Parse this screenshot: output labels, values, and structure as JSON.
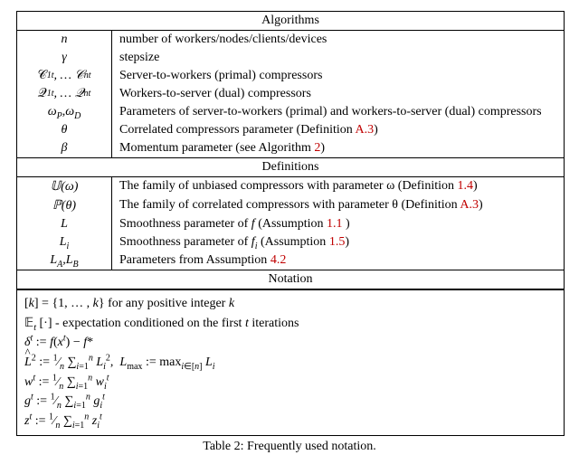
{
  "sections": {
    "algorithms": {
      "title": "Algorithms",
      "rows": [
        {
          "sym": "n",
          "desc_pre": "number of workers/nodes/clients/devices",
          "ref": "",
          "desc_post": ""
        },
        {
          "sym": "γ",
          "desc_pre": "stepsize",
          "ref": "",
          "desc_post": ""
        },
        {
          "sym": "C1t,…Cnt",
          "desc_pre": "Server-to-workers (primal) compressors",
          "ref": "",
          "desc_post": ""
        },
        {
          "sym": "Q1t,…Qnt",
          "desc_pre": "Workers-to-server (dual) compressors",
          "ref": "",
          "desc_post": ""
        },
        {
          "sym": "ωP, ωD",
          "desc_pre": "Parameters of server-to-workers (primal) and workers-to-server (dual) compressors",
          "ref": "",
          "desc_post": ""
        },
        {
          "sym": "θ",
          "desc_pre": "Correlated compressors parameter (Definition ",
          "ref": "A.3",
          "desc_post": ")"
        },
        {
          "sym": "β",
          "desc_pre": "Momentum parameter (see Algorithm ",
          "ref": "2",
          "desc_post": ")"
        }
      ]
    },
    "definitions": {
      "title": "Definitions",
      "rows": [
        {
          "sym": "U(ω)",
          "desc_pre": "The family of unbiased compressors with parameter ω (Definition ",
          "ref": "1.4",
          "desc_post": ")"
        },
        {
          "sym": "P(θ)",
          "desc_pre": "The family of correlated compressors with parameter θ (Definition ",
          "ref": "A.3",
          "desc_post": ")"
        },
        {
          "sym": "L",
          "desc_pre": "Smoothness parameter of f (Assumption ",
          "ref": "1.1",
          "desc_post": " )"
        },
        {
          "sym": "Li",
          "desc_pre": "Smoothness parameter of fi (Assumption ",
          "ref": "1.5",
          "desc_post": ")"
        },
        {
          "sym": "LA, LB",
          "desc_pre": "Parameters from Assumption ",
          "ref": "4.2",
          "desc_post": ""
        }
      ]
    },
    "notation": {
      "title": "Notation",
      "lines": {
        "l1": "[k] = {1, … , k} for any positive integer k",
        "l2": "𝔼t [·] - expectation conditioned on the first t iterations",
        "l3": "δt := f(xt) − f*",
        "l4": "L̂2 := 1/n ∑i=1n Li2,  Lmax := maxi∈[n] Li",
        "l5": "wt := 1/n ∑i=1n wit",
        "l6": "gt := 1/n ∑i=1n git",
        "l7": "zt := 1/n ∑i=1n zit"
      }
    }
  },
  "caption": "Table 2: Frequently used notation."
}
